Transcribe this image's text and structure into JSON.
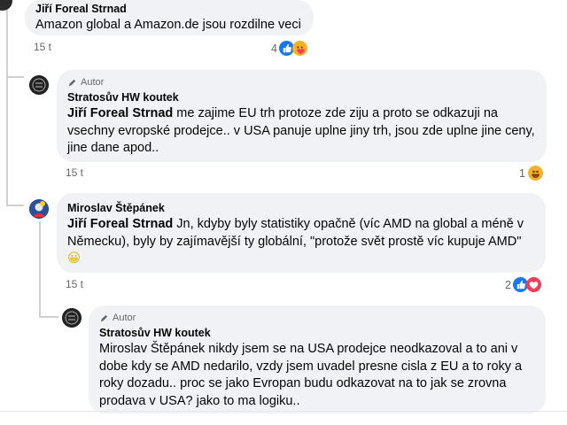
{
  "comments": [
    {
      "name": "Jiří Foreal Strnad",
      "text": "Amazon global a Amazon.de jsou rozdilne veci",
      "time": "15 t",
      "reaction_count": "4",
      "reactions": [
        "like",
        "care"
      ]
    },
    {
      "author_tag": "Autor",
      "name": "Stratosův HW koutek",
      "mention": "Jiří Foreal Strnad",
      "text_lines": [
        " me zajime EU trh protoze zde ziju a proto se odkazuji na",
        "vsechny evropské prodejce.. v USA panuje uplne jiny trh, jsou zde uplne jine ceny,",
        "jine dane apod.."
      ],
      "time": "15 t",
      "reaction_count": "1",
      "reactions": [
        "haha"
      ]
    },
    {
      "name": "Miroslav Štěpánek",
      "mention": "Jiří Foreal Strnad",
      "text_lines": [
        " Jn, kdyby byly statistiky opačně (víc AMD na global a méně v",
        "Německu), byly by zajímavější ty globální, \"protože svět prostě víc kupuje AMD\""
      ],
      "emoji": "😀",
      "time": "15 t",
      "reaction_count": "2",
      "reactions": [
        "like",
        "love"
      ]
    },
    {
      "author_tag": "Autor",
      "name": "Stratosův HW koutek",
      "text_lines": [
        "Miroslav Štěpánek nikdy jsem se na USA prodejce neodkazoval a to ani v",
        "dobe kdy se AMD nedarilo, vzdy jsem uvadel presne cisla z EU a to roky a",
        "roky dozadu.. proc se jako Evropan budu odkazovat na to jak se zrovna",
        "prodava v USA? jako to ma logiku.."
      ]
    }
  ],
  "colors": {
    "bubble": "#f0f2f5",
    "meta_text": "#65676b",
    "like": "#1877f2",
    "love": "#f33e58",
    "haha": "#f7b125",
    "thread_line": "#ced0d4"
  }
}
